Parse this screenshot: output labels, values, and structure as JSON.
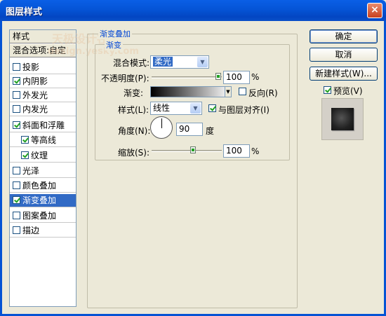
{
  "window": {
    "title": "图层样式",
    "close_glyph": "×"
  },
  "watermark": {
    "line1": "天极设计在线",
    "line2": "design.yesky.com"
  },
  "styles_list": {
    "header": "样式",
    "blend_options": "混合选项:自定",
    "items": [
      {
        "label": "投影",
        "checked": false
      },
      {
        "label": "内阴影",
        "checked": true
      },
      {
        "label": "外发光",
        "checked": false
      },
      {
        "label": "内发光",
        "checked": false
      },
      {
        "label": "斜面和浮雕",
        "checked": true
      },
      {
        "label": "等高线",
        "checked": true
      },
      {
        "label": "纹理",
        "checked": true
      },
      {
        "label": "光泽",
        "checked": false
      },
      {
        "label": "颜色叠加",
        "checked": false
      },
      {
        "label": "渐变叠加",
        "checked": true
      },
      {
        "label": "图案叠加",
        "checked": false
      },
      {
        "label": "描边",
        "checked": false
      }
    ]
  },
  "panel": {
    "outer_title": "渐变叠加",
    "inner_title": "渐变",
    "blend_mode_label": "混合模式:",
    "blend_mode_value": "柔光",
    "opacity_label": "不透明度(P):",
    "opacity_value": "100",
    "opacity_unit": "%",
    "opacity_level": 100,
    "gradient_label": "渐变:",
    "reverse_label": "反向(R)",
    "reverse_checked": false,
    "style_label": "样式(L):",
    "style_value": "线性",
    "align_label": "与图层对齐(I)",
    "align_checked": true,
    "angle_label": "角度(N):",
    "angle_value": "90",
    "angle_unit": "度",
    "scale_label": "缩放(S):",
    "scale_value": "100",
    "scale_unit": "%",
    "scale_level": 100
  },
  "buttons": {
    "ok": "确定",
    "cancel": "取消",
    "new_style": "新建样式(W)...",
    "preview_label": "预览(V)",
    "preview_checked": true
  }
}
